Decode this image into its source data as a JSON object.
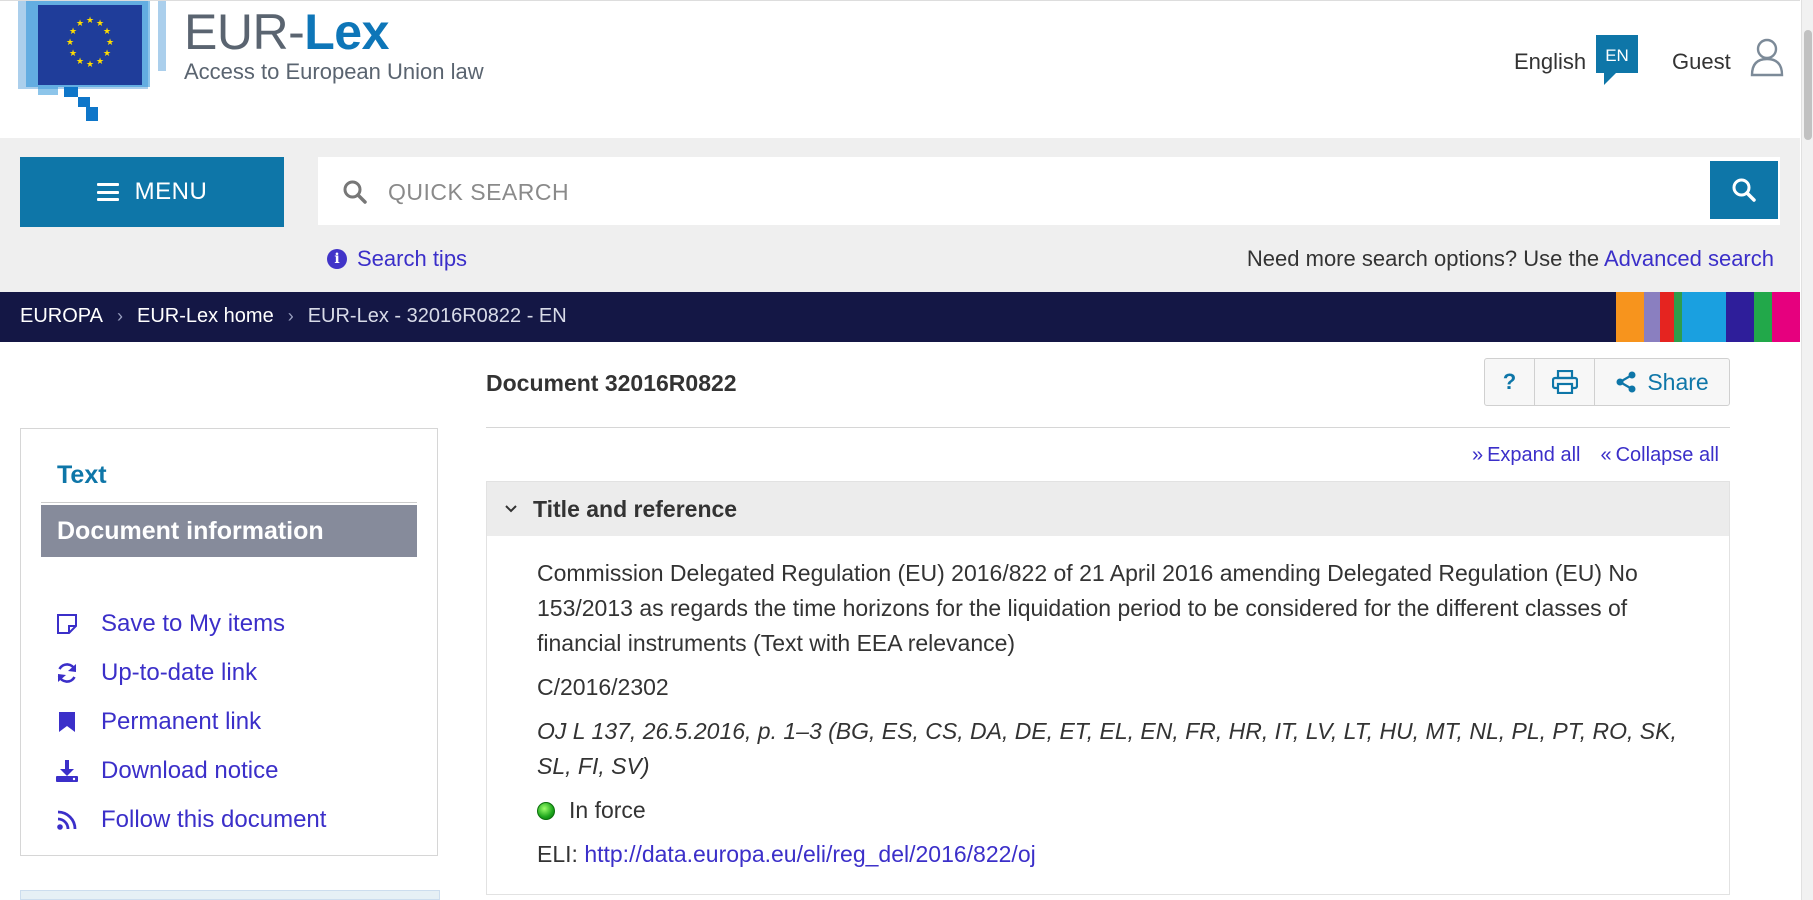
{
  "header": {
    "brand_eur": "EUR-",
    "brand_lex": "Lex",
    "brand_subtitle": "Access to European Union law",
    "language": "English",
    "language_code": "EN",
    "user": "Guest"
  },
  "search": {
    "menu_label": "MENU",
    "placeholder": "QUICK SEARCH",
    "tips_label": "Search tips",
    "more_options_text": "Need more search options? Use the ",
    "advanced_label": "Advanced search"
  },
  "breadcrumb": {
    "items": [
      "EUROPA",
      "EUR-Lex home",
      "EUR-Lex - 32016R0822 - EN"
    ]
  },
  "sidebar": {
    "text_tab": "Text",
    "docinfo_tab": "Document information",
    "actions": [
      {
        "label": "Save to My items",
        "icon": "note-icon"
      },
      {
        "label": "Up-to-date link",
        "icon": "refresh-icon"
      },
      {
        "label": "Permanent link",
        "icon": "bookmark-icon"
      },
      {
        "label": "Download notice",
        "icon": "download-icon"
      },
      {
        "label": "Follow this document",
        "icon": "rss-icon"
      }
    ]
  },
  "document": {
    "title": "Document 32016R0822",
    "help_label": "?",
    "share_label": "Share",
    "expand_all": "Expand all",
    "collapse_all": "Collapse all",
    "section_title": "Title and reference",
    "full_title": "Commission Delegated Regulation (EU) 2016/822 of 21 April 2016 amending Delegated Regulation (EU) No 153/2013 as regards the time horizons for the liquidation period to be considered for the different classes of financial instruments (Text with EEA relevance)",
    "reference": "C/2016/2302",
    "oj": "OJ L 137, 26.5.2016, p. 1–3 (BG, ES, CS, DA, DE, ET, EL, EN, FR, HR, IT, LV, LT, HU, MT, NL, PL, PT, RO, SK, SL, FI, SV)",
    "status": "In force",
    "eli_label": "ELI: ",
    "eli_url": "http://data.europa.eu/eli/reg_del/2016/822/oj"
  },
  "colors": {
    "primary": "#0e76a8",
    "link": "#3b2fc9",
    "breadcrumb_bg": "#141745",
    "sidebar_active": "#868b9b",
    "status_green": "#1ca51c"
  }
}
